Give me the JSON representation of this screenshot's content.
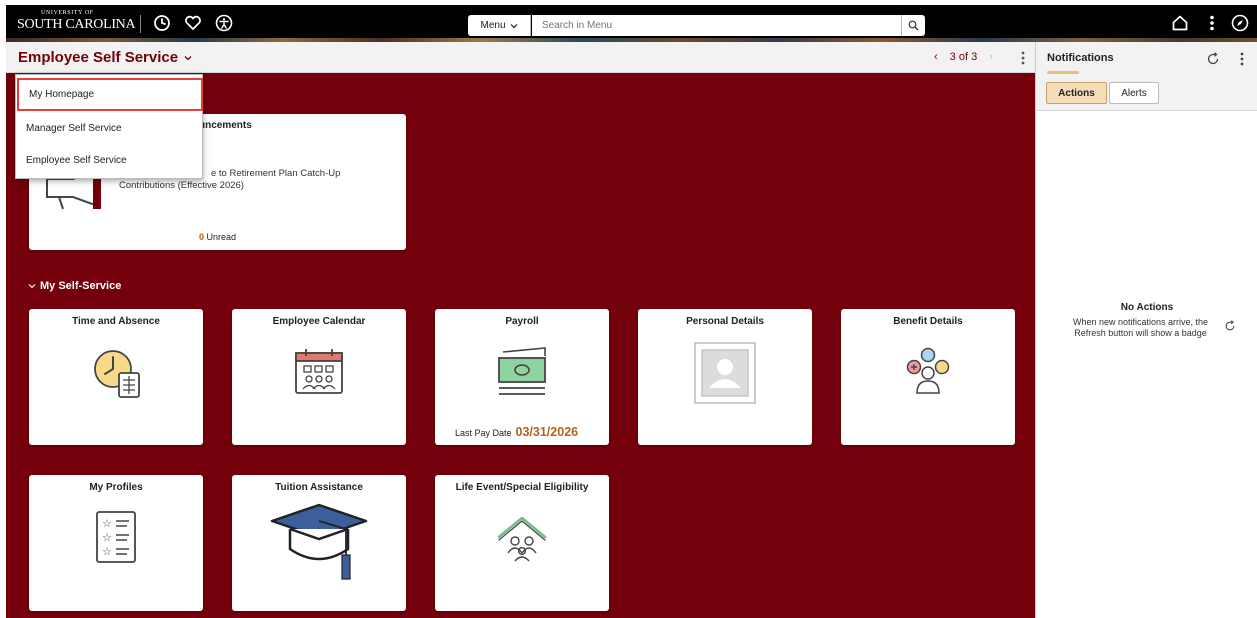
{
  "topbar": {
    "logo_line1": "UNIVERSITY OF",
    "logo_line2": "SOUTH CAROLINA",
    "menu_label": "Menu",
    "search_placeholder": "Search in Menu"
  },
  "header": {
    "title": "Employee Self Service",
    "pager_text": "3 of 3"
  },
  "dropdown": {
    "items": [
      {
        "label": "My Homepage",
        "selected": true
      },
      {
        "label": "Manager Self Service"
      },
      {
        "label": "Employee Self Service"
      }
    ]
  },
  "announcements": {
    "title_partial": "uncements",
    "item_text_a": "e to Retirement Plan Catch-Up",
    "item_text_b": "Contributions (Effective 2026)",
    "unread_count": "0",
    "unread_label": "Unread"
  },
  "section": {
    "label": "My Self-Service"
  },
  "tiles": {
    "time_absence": "Time and Absence",
    "employee_calendar": "Employee Calendar",
    "payroll": "Payroll",
    "payroll_last_pay_label": "Last Pay Date",
    "payroll_last_pay_date": "03/31/2026",
    "personal_details": "Personal Details",
    "benefit_details": "Benefit Details",
    "my_profiles": "My Profiles",
    "tuition_assistance": "Tuition Assistance",
    "life_event": "Life Event/Special Eligibility"
  },
  "notifications": {
    "title": "Notifications",
    "tab_actions": "Actions",
    "tab_alerts": "Alerts",
    "empty_title": "No Actions",
    "empty_desc": "When new notifications arrive, the Refresh button will show a badge"
  },
  "colors": {
    "brand_maroon": "#73000a",
    "date_orange": "#b4621e",
    "highlight_red": "#e5413a"
  }
}
